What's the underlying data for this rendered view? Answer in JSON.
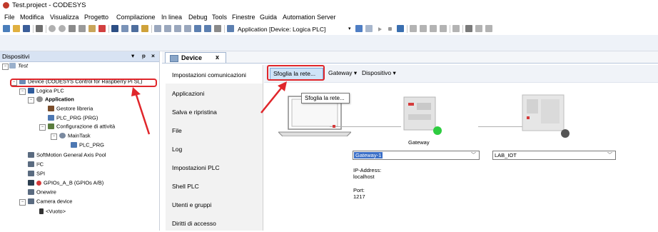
{
  "window": {
    "title": "Test.project - CODESYS"
  },
  "menu": [
    "File",
    "Modifica",
    "Visualizza",
    "Progetto",
    "Compilazione",
    "In linea",
    "Debug",
    "Tools",
    "Finestre",
    "Guida",
    "Automation Server"
  ],
  "toolbar": {
    "application_label": "Application [Device: Logica PLC]"
  },
  "left_panel": {
    "title": "Dispositivi",
    "controls": [
      "▾",
      "ᵽ",
      "×"
    ],
    "tree": [
      {
        "label": "Test",
        "icon": "project-icon",
        "italic": true
      },
      {
        "label": "Device (CODESYS Control for Raspberry Pi SL)",
        "icon": "device-icon"
      },
      {
        "label": "Logica PLC",
        "icon": "plc-logic-icon"
      },
      {
        "label": "Application",
        "icon": "application-icon",
        "bold": true
      },
      {
        "label": "Gestore libreria",
        "icon": "library-icon"
      },
      {
        "label": "PLC_PRG (PRG)",
        "icon": "program-icon"
      },
      {
        "label": "Configurazione di attività",
        "icon": "task-config-icon"
      },
      {
        "label": "MainTask",
        "icon": "task-icon"
      },
      {
        "label": "PLC_PRG",
        "icon": "program-call-icon"
      },
      {
        "label": "SoftMotion General Axis Pool",
        "icon": "softmotion-icon"
      },
      {
        "label": "I²C",
        "icon": "bus-icon"
      },
      {
        "label": "SPI",
        "icon": "bus-icon"
      },
      {
        "label": "GPIOs_A_B (GPIOs A/B)",
        "icon": "gpio-icon"
      },
      {
        "label": "Onewire",
        "icon": "bus-icon"
      },
      {
        "label": "Camera device",
        "icon": "camera-icon"
      },
      {
        "label": "<Vuoto>",
        "icon": "empty-slot-icon"
      }
    ]
  },
  "editor": {
    "tab_label": "Device",
    "tab_close": "x",
    "nav": [
      "Impostazioni comunicazioni",
      "Applicazioni",
      "Salva e ripristina",
      "File",
      "Log",
      "Impostazioni PLC",
      "Shell PLC",
      "Utenti e gruppi",
      "Diritti di accesso"
    ],
    "commands": {
      "scan": "Sfoglia la rete...",
      "gateway": "Gateway ▾",
      "device": "Dispositivo ▾"
    },
    "tooltip": "Sfoglia la rete...",
    "gateway_label": "Gateway",
    "gateway_select": "Gateway-1",
    "ip_label": "IP-Address:",
    "ip_value": "localhost",
    "port_label": "Port:",
    "port_value": "1217",
    "device_select": "LAB_IOT"
  },
  "colors": {
    "highlight": "#e0262b",
    "online": "#2ecc40",
    "offline": "#555555",
    "selection": "#cfe3f7"
  }
}
